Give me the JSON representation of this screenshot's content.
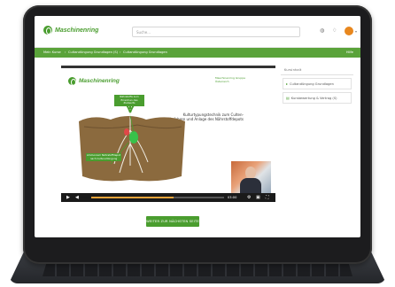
{
  "header": {
    "brand": "Maschinenring",
    "search_placeholder": "Suche...",
    "icons": [
      "globe-icon",
      "bell-icon",
      "user-avatar"
    ]
  },
  "breadcrumb": {
    "items": [
      "Mein Kurse",
      "Cultandüngung Grundlagen (S)",
      "Cultandüngung Grundlagen"
    ],
    "right": "Hilfe"
  },
  "video": {
    "brand": "Maschinenring",
    "top_right": "Maschinenring Gruppe Österreich",
    "caption": "Kulturtypungstechnik zum Culten-Verfahren und Anlage des Nährstoffdepots",
    "label_top": "Nährstoffe zum Erreichen des Zielwerts",
    "label_bottom": "Ammonium Nährstoffdepot nach Culten-Düngung",
    "time": "03:00",
    "progress": 0.62
  },
  "next_button": "WEITER ZUR NÄCHSTEN SEITE",
  "sidebar": {
    "heading": "Kursinhalt",
    "items": [
      {
        "icon": "play-icon",
        "label": "Cultandüngung Grundlagen"
      },
      {
        "icon": "document-icon",
        "label": "Kursbewertung & Vertrag (S)"
      }
    ]
  },
  "colors": {
    "brand": "#4a9d2f",
    "nav": "#5aa33a",
    "accent": "#e8871e"
  }
}
